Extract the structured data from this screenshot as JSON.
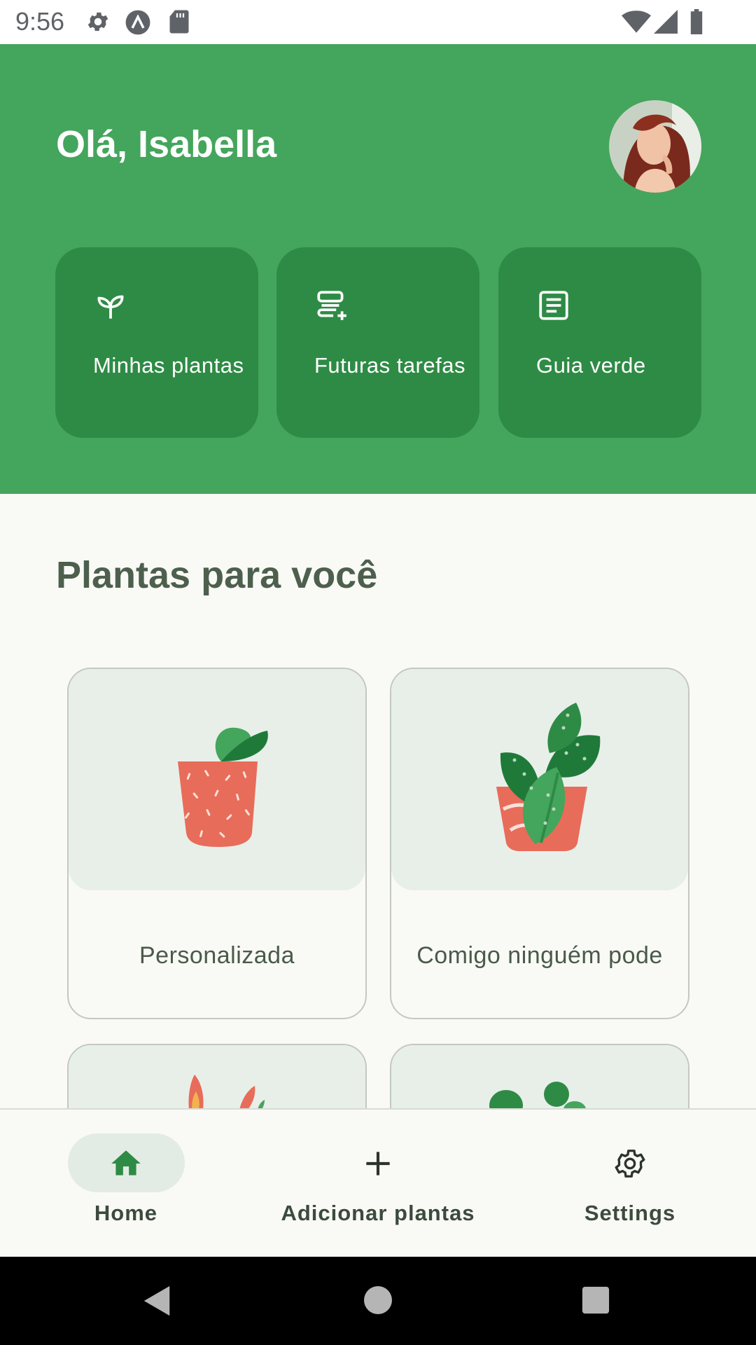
{
  "status_bar": {
    "time": "9:56"
  },
  "header": {
    "greeting": "Olá, Isabella",
    "quick_actions": [
      {
        "label": "Minhas plantas",
        "icon": "sprout-icon"
      },
      {
        "label": "Futuras tarefas",
        "icon": "add-task-list-icon"
      },
      {
        "label": "Guia verde",
        "icon": "article-icon"
      }
    ]
  },
  "section": {
    "title": "Plantas para você"
  },
  "plants": [
    {
      "name": "Personalizada"
    },
    {
      "name": "Comigo ninguém pode"
    }
  ],
  "bottom_nav": {
    "items": [
      {
        "label": "Home",
        "icon": "home-icon",
        "selected": true
      },
      {
        "label": "Adicionar plantas",
        "icon": "plus-icon",
        "selected": false
      },
      {
        "label": "Settings",
        "icon": "gear-icon",
        "selected": false
      }
    ]
  },
  "colors": {
    "primary": "#44a55c",
    "card_dark": "#2e8b45",
    "terracotta": "#e86c5a",
    "leaf_dark": "#1f7a3a"
  }
}
